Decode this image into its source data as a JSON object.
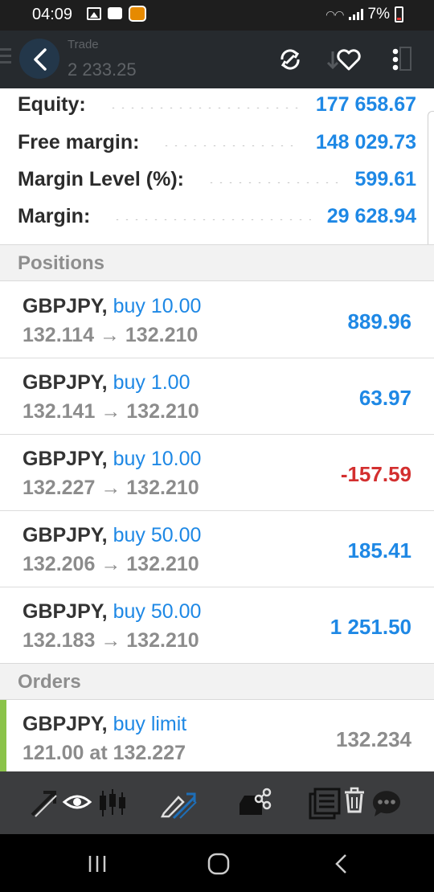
{
  "status_bar": {
    "time": "04:09",
    "battery": "7%"
  },
  "toolbar": {
    "title": "Trade",
    "balance": "2 233.25"
  },
  "summary": [
    {
      "label": "Equity:",
      "value": "177 658.67"
    },
    {
      "label": "Free margin:",
      "value": "148 029.73"
    },
    {
      "label": "Margin Level (%):",
      "value": "599.61"
    },
    {
      "label": "Margin:",
      "value": "29 628.94"
    }
  ],
  "sections": {
    "positions": "Positions",
    "orders": "Orders"
  },
  "positions": [
    {
      "symbol": "GBPJPY,",
      "type": "buy 10.00",
      "open": "132.114",
      "arrow": "→",
      "current": "132.210",
      "profit": "889.96"
    },
    {
      "symbol": "GBPJPY,",
      "type": "buy 1.00",
      "open": "132.141",
      "arrow": "→",
      "current": "132.210",
      "profit": "63.97"
    },
    {
      "symbol": "GBPJPY,",
      "type": "buy 10.00",
      "open": "132.227",
      "arrow": "→",
      "current": "132.210",
      "profit": "-157.59"
    },
    {
      "symbol": "GBPJPY,",
      "type": "buy 50.00",
      "open": "132.206",
      "arrow": "→",
      "current": "132.210",
      "profit": "185.41"
    },
    {
      "symbol": "GBPJPY,",
      "type": "buy 50.00",
      "open": "132.183",
      "arrow": "→",
      "current": "132.210",
      "profit": "1 251.50"
    }
  ],
  "orders": [
    {
      "symbol": "GBPJPY,",
      "type": "buy limit",
      "volume": "121.00",
      "at": "at",
      "price": "132.227",
      "current": "132.234"
    }
  ],
  "colors": {
    "accent_blue": "#1e88e5",
    "loss_red": "#d32f2f",
    "order_accent": "#8bc34a",
    "toolbar_bg": "#262a2e",
    "action_bar_bg": "#3c3d3f"
  },
  "icons": {
    "toolbar": [
      "back-arrow-icon",
      "sync-icon",
      "heart-icon",
      "more-vert-icon"
    ],
    "action_bar": [
      "modify-icon",
      "eye-icon",
      "candlestick-icon",
      "pencil-icon",
      "tray-share-icon",
      "report-icon",
      "trash-icon",
      "chat-icon"
    ],
    "nav": [
      "recents-icon",
      "home-icon",
      "back-icon"
    ]
  }
}
